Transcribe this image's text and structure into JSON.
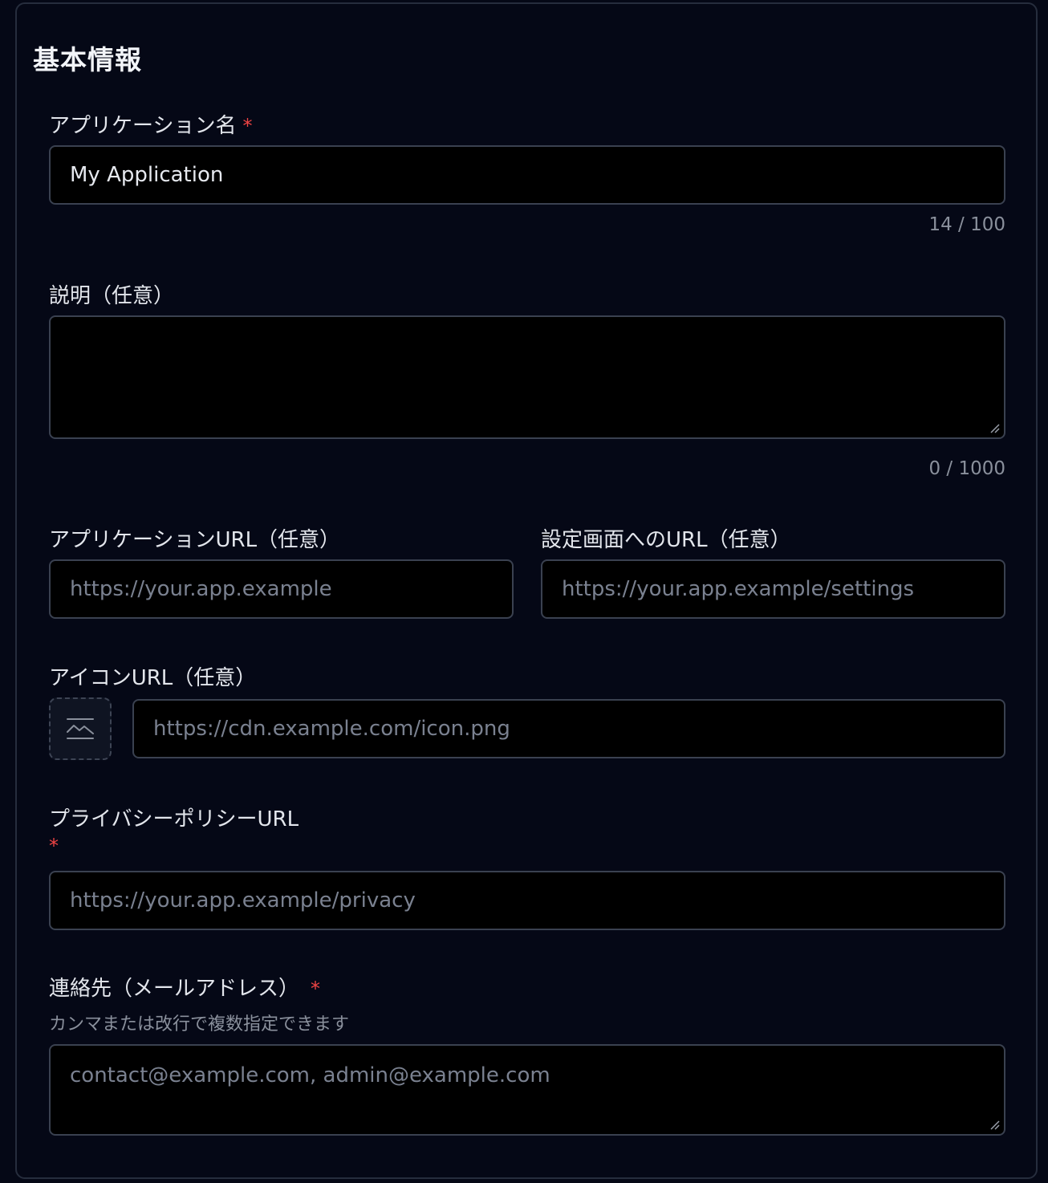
{
  "section": {
    "title": "基本情報"
  },
  "fields": {
    "app_name": {
      "label": "アプリケーション名",
      "required_mark": "*",
      "value": "My Application",
      "counter": "14 / 100"
    },
    "description": {
      "label": "説明（任意）",
      "value": "",
      "counter": "0 / 1000"
    },
    "app_url": {
      "label": "アプリケーションURL（任意）",
      "placeholder": "https://your.app.example"
    },
    "settings_url": {
      "label": "設定画面へのURL（任意）",
      "placeholder": "https://your.app.example/settings"
    },
    "icon_url": {
      "label": "アイコンURL（任意）",
      "placeholder": "https://cdn.example.com/icon.png",
      "preview_icon": "image-placeholder-icon"
    },
    "privacy_url": {
      "label": "プライバシーポリシーURL",
      "required_mark": "*",
      "placeholder": "https://your.app.example/privacy"
    },
    "contact": {
      "label": "連絡先（メールアドレス）",
      "required_mark": "*",
      "hint": "カンマまたは改行で複数指定できます",
      "placeholder": "contact@example.com, admin@example.com"
    }
  },
  "colors": {
    "background": "#050816",
    "input_background": "#000000",
    "border": "#3a4150",
    "required": "#ef4444",
    "placeholder": "#7a8190"
  }
}
